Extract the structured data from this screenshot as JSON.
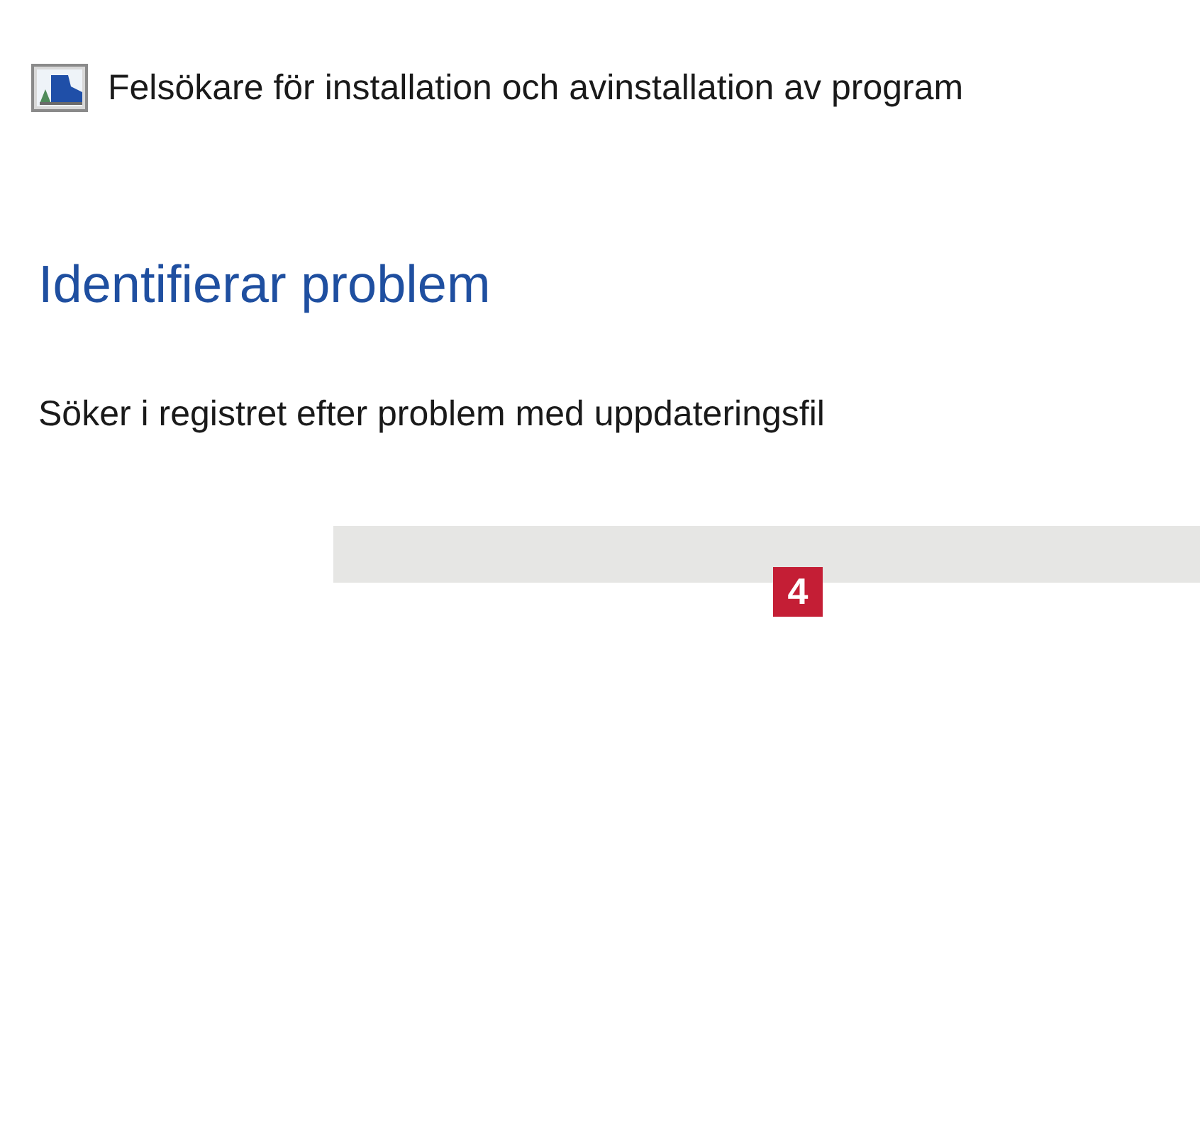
{
  "window": {
    "title": "Felsökare för installation och avinstallation av program"
  },
  "heading": "Identifierar problem",
  "status_text": "Söker i registret efter problem med uppdateringsfil",
  "progress": {
    "level": 0
  },
  "callout": {
    "label": "4"
  }
}
